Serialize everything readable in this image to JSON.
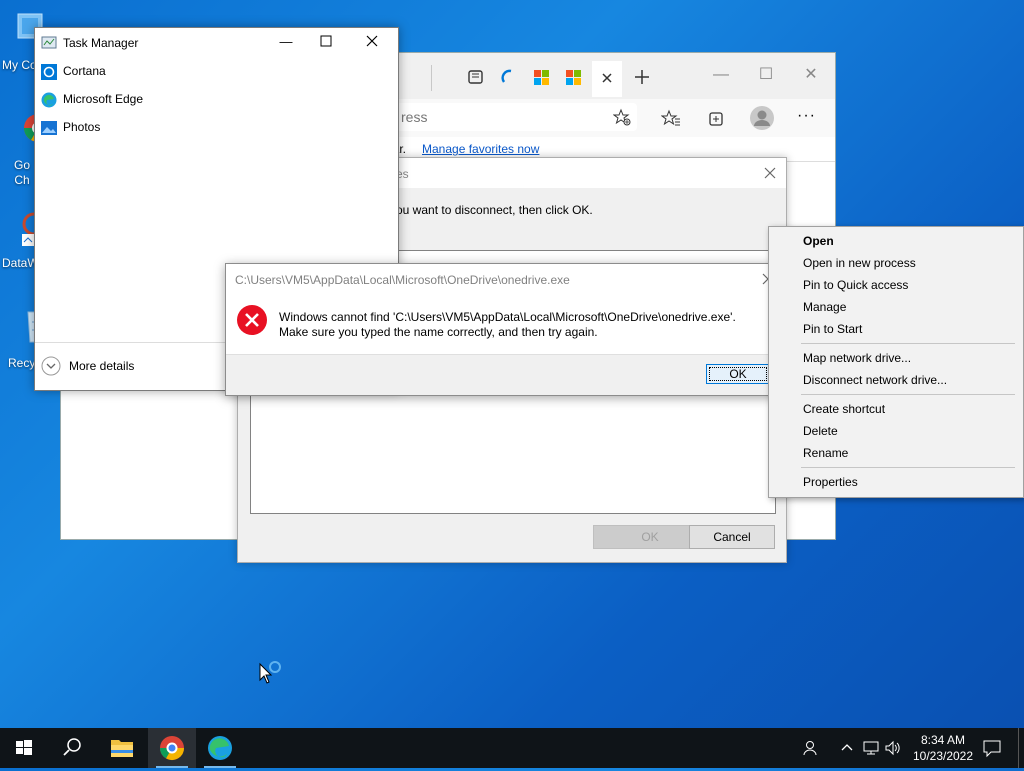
{
  "desktop": {
    "icons": [
      {
        "label": "My Co"
      },
      {
        "label": "Go\nCh"
      },
      {
        "label": "DataW"
      },
      {
        "label": "Recy"
      }
    ]
  },
  "edge": {
    "address_fragment": "ress",
    "favbar_text": "bar.",
    "manage_favorites": "Manage favorites now"
  },
  "disconnect_dialog": {
    "title_fragment": "es",
    "instruction": "ou want to disconnect, then click OK.",
    "ok_label": "OK",
    "cancel_label": "Cancel"
  },
  "task_manager": {
    "title": "Task Manager",
    "apps": [
      {
        "name": "Cortana",
        "icon": "cortana-icon"
      },
      {
        "name": "Microsoft Edge",
        "icon": "edge-icon"
      },
      {
        "name": "Photos",
        "icon": "photos-icon"
      }
    ],
    "more_details": "More details"
  },
  "error_dialog": {
    "title": "C:\\Users\\VM5\\AppData\\Local\\Microsoft\\OneDrive\\onedrive.exe",
    "line1": "Windows cannot find 'C:\\Users\\VM5\\AppData\\Local\\Microsoft\\OneDrive\\onedrive.exe'.",
    "line2": "Make sure you typed the name correctly, and then try again.",
    "ok_label": "OK"
  },
  "context_menu": {
    "items": [
      "Open",
      "Open in new process",
      "Pin to Quick access",
      "Manage",
      "Pin to Start",
      "Map network drive...",
      "Disconnect network drive...",
      "Create shortcut",
      "Delete",
      "Rename",
      "Properties"
    ]
  },
  "taskbar": {
    "time": "8:34 AM",
    "date": "10/23/2022"
  },
  "colors": {
    "accent": "#0078d7",
    "error_red": "#e81123",
    "taskbar": "#0f1418",
    "link": "#0a58ca"
  }
}
